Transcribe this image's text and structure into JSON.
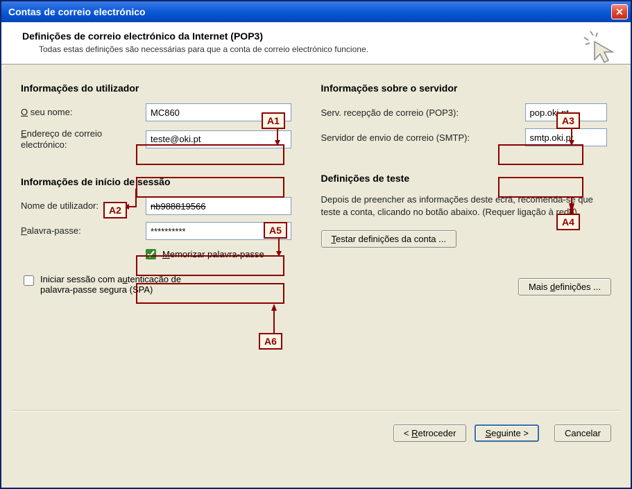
{
  "window": {
    "title": "Contas de correio electrónico"
  },
  "header": {
    "title": "Definições de correio electrónico da Internet (POP3)",
    "subtitle": "Todas estas definições são necessárias para que a conta de correio electrónico funcione."
  },
  "sections": {
    "user_info": "Informações do utilizador",
    "server_info": "Informações sobre o servidor",
    "login_info": "Informações de início de sessão",
    "test_info": "Definições de teste"
  },
  "labels": {
    "your_name_pre": "O",
    "your_name_post": " seu nome:",
    "email_pre": "E",
    "email_post": "ndereço de correio electrónico:",
    "pop3": "Serv. recepção de correio (POP3):",
    "smtp": "Servidor de envio de correio (SMTP):",
    "username": "Nome de utilizador:",
    "password_pre": "P",
    "password_post": "alavra-passe:",
    "remember_pre": "M",
    "remember_post": "emorizar palavra-passe",
    "spa_line1a": "Iniciar sessão com a",
    "spa_line1b": "u",
    "spa_line1c": "tenticação de",
    "spa_line2": "palavra-passe segura (SPA)"
  },
  "values": {
    "name": "MC860",
    "email": "teste@oki.pt",
    "pop3": "pop.oki.pt",
    "smtp": "smtp.oki.pt",
    "username": "nb988819566",
    "password": "**********"
  },
  "test": {
    "desc": "Depois de preencher as informações deste ecrã, recomenda-se que teste a conta, clicando no botão abaixo. (Requer ligação à rede)"
  },
  "buttons": {
    "test_pre": "T",
    "test_post": "estar definições da conta ...",
    "more_pre": "Mais ",
    "more_u": "d",
    "more_post": "efinições ...",
    "back_pre": "< ",
    "back_u": "R",
    "back_post": "etroceder",
    "next_pre": "S",
    "next_post": "eguinte >",
    "cancel": "Cancelar"
  },
  "annotations": {
    "a1": "A1",
    "a2": "A2",
    "a3": "A3",
    "a4": "A4",
    "a5": "A5",
    "a6": "A6"
  }
}
